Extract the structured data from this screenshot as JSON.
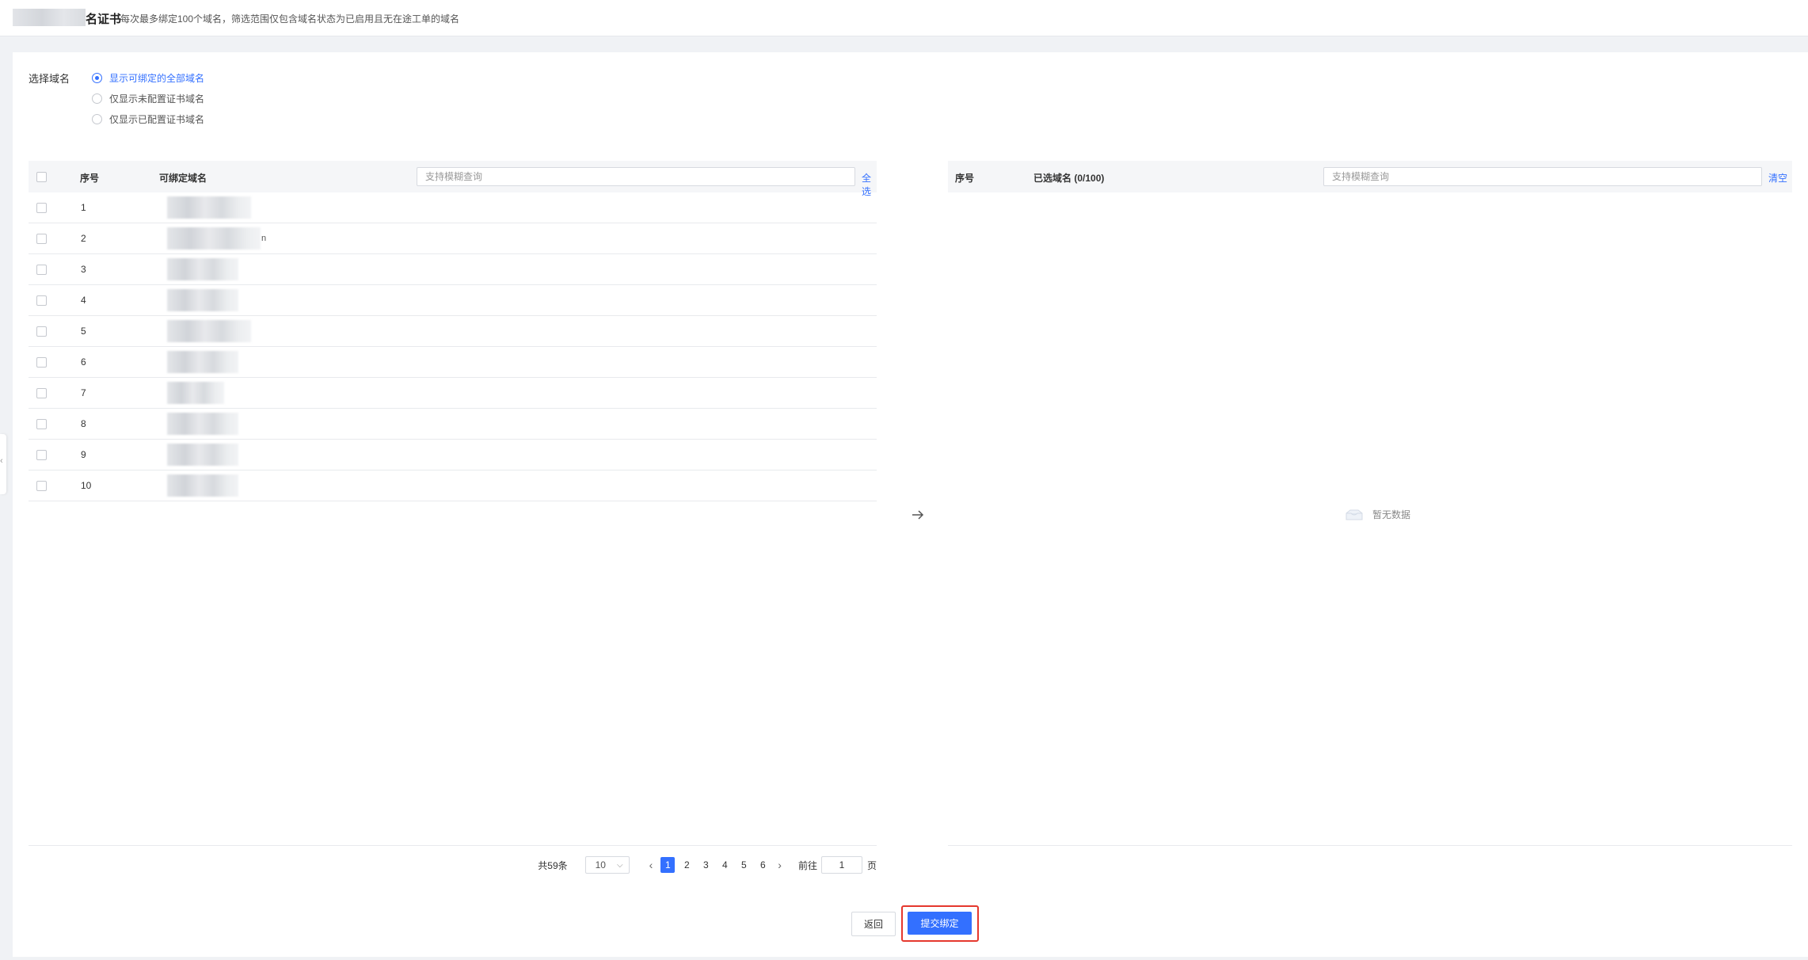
{
  "header": {
    "title": "名证书",
    "description": "每次最多绑定100个域名，筛选范围仅包含域名状态为已启用且无在途工单的域名"
  },
  "filter": {
    "label": "选择域名",
    "options": [
      {
        "label": "显示可绑定的全部域名",
        "selected": true
      },
      {
        "label": "仅显示未配置证书域名",
        "selected": false
      },
      {
        "label": "仅显示已配置证书域名",
        "selected": false
      }
    ]
  },
  "left_table": {
    "col_number": "序号",
    "col_domain": "可绑定域名",
    "search_placeholder": "支持模糊查询",
    "select_all": "全选",
    "rows": [
      {
        "num": "1",
        "suffix": ""
      },
      {
        "num": "2",
        "suffix": "n"
      },
      {
        "num": "3",
        "suffix": ""
      },
      {
        "num": "4",
        "suffix": ""
      },
      {
        "num": "5",
        "suffix": ""
      },
      {
        "num": "6",
        "suffix": ""
      },
      {
        "num": "7",
        "suffix": ""
      },
      {
        "num": "8",
        "suffix": ""
      },
      {
        "num": "9",
        "suffix": ""
      },
      {
        "num": "10",
        "suffix": ""
      }
    ]
  },
  "pagination": {
    "total": "共59条",
    "page_size": "10",
    "pages": [
      "1",
      "2",
      "3",
      "4",
      "5",
      "6"
    ],
    "current_page": "1",
    "goto_label": "前往",
    "goto_value": "1",
    "goto_unit": "页"
  },
  "right_table": {
    "col_number": "序号",
    "title": "已选域名",
    "count": "(0/100)",
    "search_placeholder": "支持模糊查询",
    "clear": "清空",
    "empty_text": "暂无数据"
  },
  "actions": {
    "back": "返回",
    "submit": "提交绑定"
  },
  "colors": {
    "primary": "#3370ff",
    "highlight_border": "#e5382e"
  }
}
